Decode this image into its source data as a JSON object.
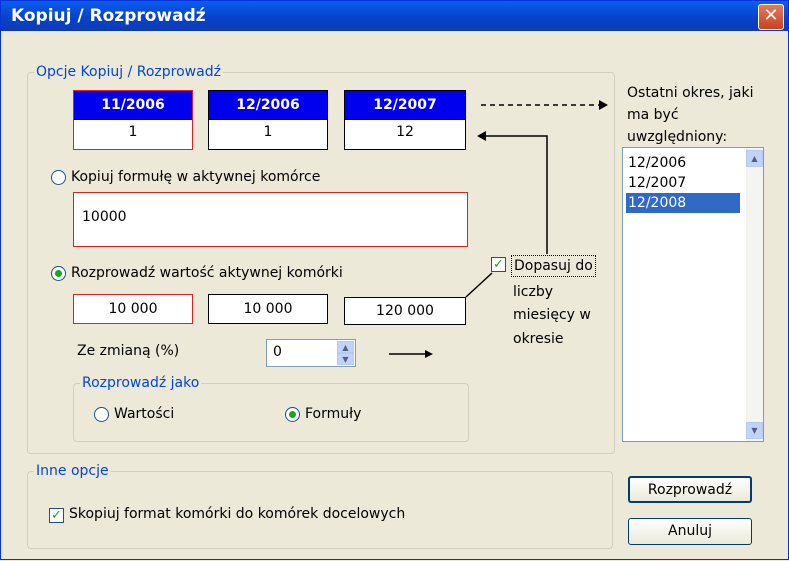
{
  "window": {
    "title": "Kopiuj / Rozprowadź",
    "close_glyph": "✕"
  },
  "main_group": {
    "legend": "Opcje Kopiuj / Rozprowadź"
  },
  "periods": [
    {
      "label": "11/2006",
      "value": "1"
    },
    {
      "label": "12/2006",
      "value": "1"
    },
    {
      "label": "12/2007",
      "value": "12"
    }
  ],
  "copy_formula": {
    "label": "Kopiuj formułę w aktywnej komórce",
    "value": "10000",
    "selected": false
  },
  "distribute": {
    "label": "Rozprowadź wartość aktywnej komórki",
    "selected": true,
    "values": [
      "10 000",
      "10 000",
      "120 000"
    ]
  },
  "adjust": {
    "label_lines": [
      "Dopasuj do",
      "liczby",
      "miesięcy w",
      "okresie"
    ],
    "checked": true
  },
  "change": {
    "label": "Ze zmianą (%)",
    "value": "0"
  },
  "distribute_as": {
    "legend": "Rozprowadź jako",
    "options": [
      {
        "label": "Wartości",
        "selected": false
      },
      {
        "label": "Formuły",
        "selected": true
      }
    ]
  },
  "last_period": {
    "label_lines": [
      "Ostatni okres, jaki",
      "ma być",
      "uwzględniony:"
    ],
    "items": [
      {
        "label": "12/2006",
        "selected": false
      },
      {
        "label": "12/2007",
        "selected": false
      },
      {
        "label": "12/2008",
        "selected": true
      }
    ]
  },
  "other_options": {
    "legend": "Inne opcje",
    "copy_format_label": "Skopiuj format komórki do komórek docelowych",
    "copy_format_checked": true
  },
  "buttons": {
    "distribute": "Rozprowadź",
    "cancel": "Anuluj"
  },
  "icons": {
    "spinner": "spinner-icon",
    "check": "check-icon"
  },
  "colors": {
    "title_blue": "#0743c9",
    "header_blue": "#0000ee",
    "highlight_red": "#e02020",
    "selection": "#316ac5"
  }
}
